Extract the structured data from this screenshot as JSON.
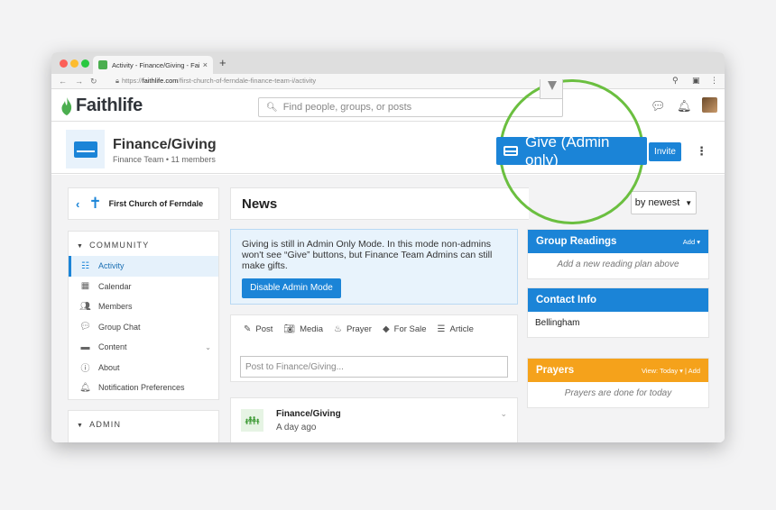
{
  "browser": {
    "tab_title": "Activity - Finance/Giving - Faith",
    "tab_close": "×",
    "new_tab": "+",
    "url_prefix": "https://",
    "url_host": "faithlife.com",
    "url_path": "/first-church-of-ferndale-finance-team-i/activity"
  },
  "header": {
    "logo": "Faithlife",
    "search_placeholder": "Find people, groups, or posts"
  },
  "group": {
    "name": "Finance/Giving",
    "meta": "Finance Team  •  11 members",
    "give_label": "Give (Admin only)",
    "invite_label": "Invite"
  },
  "sidebar": {
    "church": "First Church of Ferndale",
    "community_title": "COMMUNITY",
    "items": [
      {
        "label": "Activity",
        "icon": "activity-icon"
      },
      {
        "label": "Calendar",
        "icon": "calendar-icon"
      },
      {
        "label": "Members",
        "icon": "members-icon"
      },
      {
        "label": "Group Chat",
        "icon": "chat-icon"
      },
      {
        "label": "Content",
        "icon": "folder-icon"
      },
      {
        "label": "About",
        "icon": "info-icon"
      },
      {
        "label": "Notification Preferences",
        "icon": "bell-icon"
      }
    ],
    "admin_title": "ADMIN"
  },
  "news": {
    "title": "News",
    "sort_label": "by newest",
    "notice": "Giving is still in Admin Only Mode. In this mode non-admins won't see “Give” buttons, but Finance Team Admins can still make gifts.",
    "disable_label": "Disable Admin Mode",
    "post_types": [
      "Post",
      "Media",
      "Prayer",
      "For Sale",
      "Article"
    ],
    "post_placeholder": "Post to Finance/Giving...",
    "feed_name": "Finance/Giving",
    "feed_time": "A day ago"
  },
  "right": {
    "readings_title": "Group Readings",
    "readings_action": "Add ▾",
    "readings_body": "Add a new reading plan above",
    "contact_title": "Contact Info",
    "contact_body": "Bellingham",
    "prayers_title": "Prayers",
    "prayers_action": "View: Today ▾ | Add",
    "prayers_body": "Prayers are done for today"
  },
  "colors": {
    "accent": "#1b84d7",
    "prayers": "#f5a21b",
    "magnifier": "#6bbf40"
  }
}
